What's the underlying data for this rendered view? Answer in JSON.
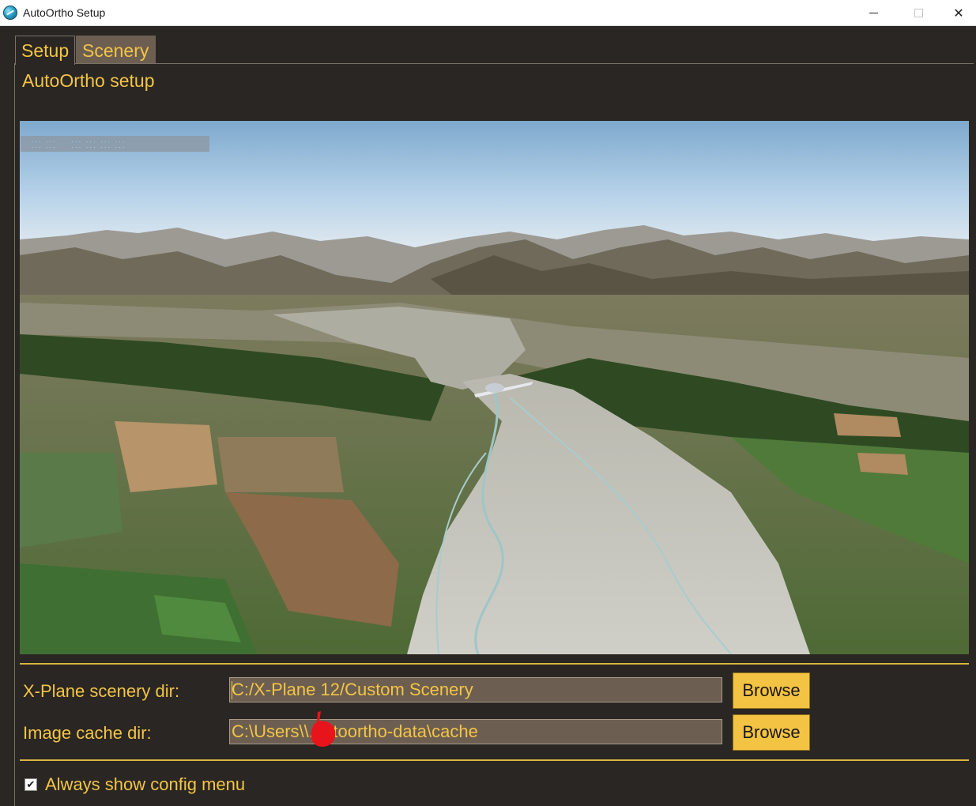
{
  "window": {
    "title": "AutoOrtho Setup",
    "icon": "globe-plane-icon",
    "controls": [
      "minimize-icon",
      "maximize-icon",
      "close-icon"
    ]
  },
  "tabs": [
    {
      "label": "Setup",
      "active": true
    },
    {
      "label": "Scenery",
      "active": false
    }
  ],
  "setup": {
    "section_title": "AutoOrtho setup",
    "scenery_dir": {
      "label": "X-Plane scenery dir:",
      "value": "C:/X-Plane 12/Custom Scenery"
    },
    "cache_dir": {
      "label": "Image cache dir:",
      "value": "C:\\Users\\\\.autoortho-data\\cache"
    },
    "browse_label": "Browse",
    "always_show": {
      "label": "Always show config menu",
      "checked": true
    }
  },
  "colors": {
    "background": "#2a2623",
    "accent_text": "#f2c545",
    "input_bg": "#6d5e52",
    "button_bg": "#f3c443",
    "separator": "#d7b53f"
  }
}
